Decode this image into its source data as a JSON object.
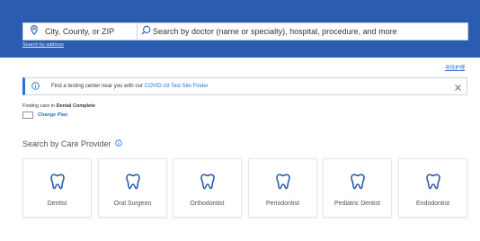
{
  "search": {
    "location_placeholder": "City, County, or ZIP",
    "query_placeholder": "Search by doctor (name or specialty), hospital, procedure, and more",
    "search_by_address": "Search by address"
  },
  "language_link": "寻找护理",
  "banner": {
    "text_before": "Find a testing center near you with our ",
    "link": "COVID-19 Test Site Finder"
  },
  "plan": {
    "finding_prefix": "Finding care in ",
    "plan_name": "Dental Complete",
    "badge": " ",
    "change_label": "Change Plan"
  },
  "section_title": "Search by Care Provider",
  "providers": [
    {
      "label": "Dentist"
    },
    {
      "label": "Oral Surgeon"
    },
    {
      "label": "Orthodontist"
    },
    {
      "label": "Periodontist"
    },
    {
      "label": "Pediatric Dentist"
    },
    {
      "label": "Endodontist"
    }
  ],
  "colors": {
    "header_blue": "#2a5db0",
    "link_blue": "#2a6fd3",
    "tooth_blue": "#2a5db0"
  },
  "icons": {
    "location": "map-pin-icon",
    "search": "magnifier-icon",
    "info": "info-circle-icon",
    "close": "close-icon",
    "help": "info-circle-icon",
    "provider": "tooth-icon"
  }
}
